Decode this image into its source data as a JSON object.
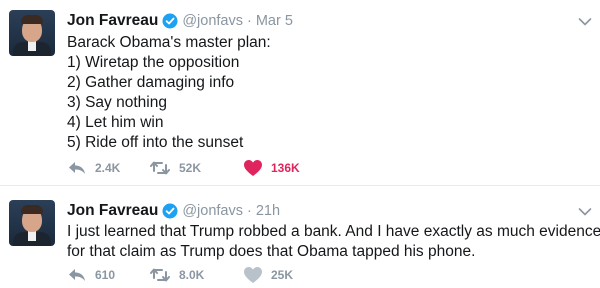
{
  "tweets": [
    {
      "author_name": "Jon Favreau",
      "handle": "@jonfavs",
      "separator": "·",
      "time": "Mar 5",
      "lines": [
        "Barack Obama's master plan:",
        "1) Wiretap the opposition",
        "2) Gather damaging info",
        "3) Say nothing",
        "4) Let him win",
        "5) Ride off into the sunset"
      ],
      "replies": "2.4K",
      "retweets": "52K",
      "likes": "136K",
      "liked": true
    },
    {
      "author_name": "Jon Favreau",
      "handle": "@jonfavs",
      "separator": "·",
      "time": "21h",
      "lines": [
        "I just learned that Trump robbed a bank. And I have exactly as much evidence",
        "for that claim as Trump does that Obama tapped his phone."
      ],
      "replies": "610",
      "retweets": "8.0K",
      "likes": "25K",
      "liked": false
    }
  ],
  "colors": {
    "verified_blue": "#1da1f2",
    "like_red": "#e0245e",
    "meta_gray": "#8a96a1",
    "divider": "#e6ecf0"
  },
  "icons": [
    "verified-badge-icon",
    "chevron-down-icon",
    "reply-icon",
    "retweet-icon",
    "heart-icon"
  ]
}
